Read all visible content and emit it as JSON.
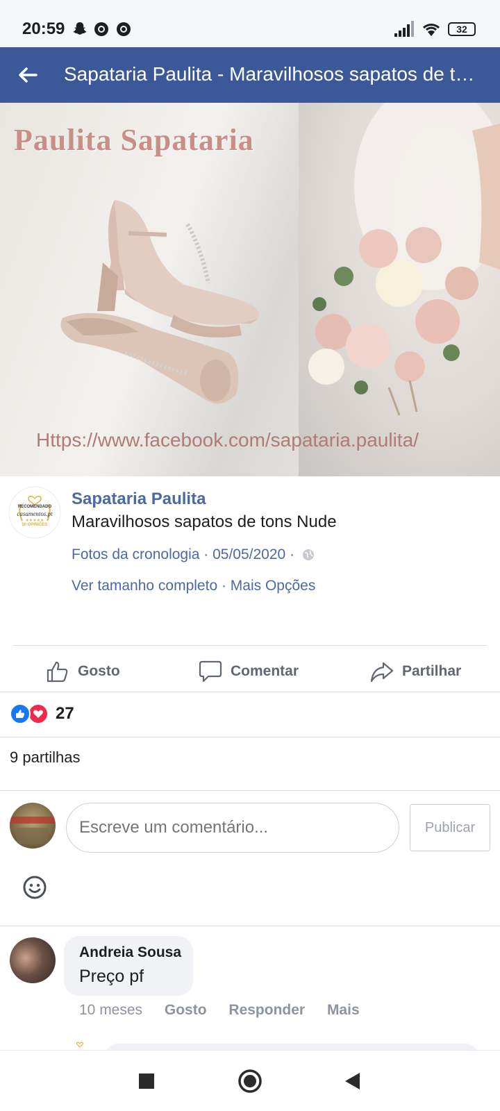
{
  "status_bar": {
    "time": "20:59",
    "left_icons": [
      "snapchat-icon",
      "chrome-icon",
      "chrome-icon"
    ],
    "right_icons": [
      "signal-icon",
      "wifi-icon",
      "battery-icon"
    ],
    "battery": "32"
  },
  "app_bar": {
    "back_icon": "arrow-left-icon",
    "title": "Sapataria Paulita - Maravilhosos sapatos de tons Nude"
  },
  "photo": {
    "brand_text": "Paulita Sapataria",
    "url_text": "Https://www.facebook.com/sapataria.paulita/"
  },
  "post": {
    "avatar_badge": {
      "line1": "RECOMENDADO",
      "line2": "casamentos.pt",
      "stars": "★★★★★",
      "line3": "50 OPINIÕES"
    },
    "author": "Sapataria Paulita",
    "caption": "Maravilhosos sapatos de tons Nude",
    "meta": "Fotos da cronologia · 05/05/2020 ·",
    "links": "Ver tamanho completo · Mais Opções"
  },
  "actions": {
    "like_label": "Gosto",
    "comment_label": "Comentar",
    "share_label": "Partilhar"
  },
  "reactions": {
    "count": "27",
    "types": [
      "like-reaction-icon",
      "love-reaction-icon"
    ]
  },
  "shares_text": "9 partilhas",
  "composer": {
    "placeholder": "Escreve um comentário...",
    "publish_label": "Publicar"
  },
  "comments": [
    {
      "author": "Andreia Sousa",
      "text": "Preço pf",
      "time": "10 meses",
      "like_label": "Gosto",
      "reply_label": "Responder",
      "more_label": "Mais"
    }
  ],
  "nav": {
    "icons": [
      "recents-square-icon",
      "home-circle-icon",
      "back-triangle-icon"
    ]
  },
  "colors": {
    "app_bar": "#3b5998",
    "link": "#4b6aa5",
    "brand_text": "#c98f86",
    "like": "#1877f2",
    "love": "#f02849"
  }
}
